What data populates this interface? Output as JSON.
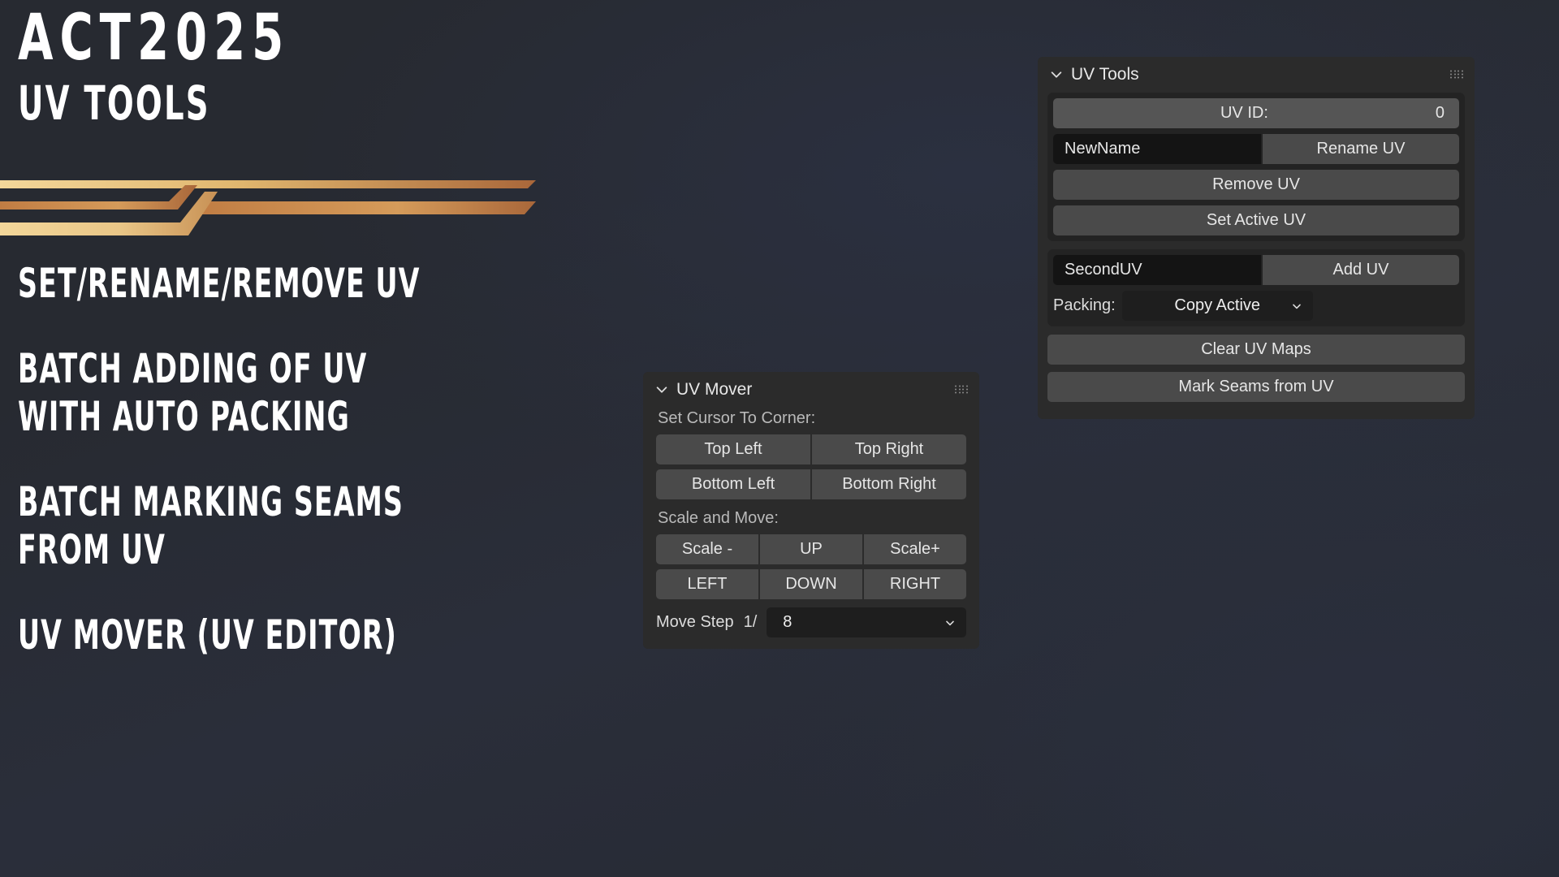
{
  "promo": {
    "title": "ACT2025",
    "subtitle": "UV TOOLS",
    "features": [
      "SET/RENAME/REMOVE UV",
      "BATCH ADDING OF UV\nWITH AUTO PACKING",
      "BATCH MARKING SEAMS\nFROM UV",
      "UV MOVER (UV EDITOR)"
    ],
    "accent_colors": {
      "gold_light": "#f3d79a",
      "gold": "#e0b66e",
      "copper": "#c07c43",
      "copper_dark": "#a9673a"
    }
  },
  "uv_tools": {
    "title": "UV Tools",
    "chevron_icon": "chevron-down-icon",
    "grip_icon": "drag-grip-icon",
    "uv_id": {
      "label": "UV ID:",
      "value": "0"
    },
    "rename": {
      "field_value": "NewName",
      "button_label": "Rename UV"
    },
    "remove_button": "Remove UV",
    "set_active_button": "Set Active UV",
    "add": {
      "field_value": "SecondUV",
      "button_label": "Add UV"
    },
    "packing": {
      "label": "Packing:",
      "selected": "Copy Active",
      "caret_icon": "chevron-down-icon"
    },
    "clear_button": "Clear UV Maps",
    "mark_seams_button": "Mark Seams from UV"
  },
  "uv_mover": {
    "title": "UV Mover",
    "chevron_icon": "chevron-down-icon",
    "grip_icon": "drag-grip-icon",
    "cursor_section_label": "Set Cursor To Corner:",
    "corner_buttons": [
      "Top Left",
      "Top Right",
      "Bottom Left",
      "Bottom Right"
    ],
    "scale_section_label": "Scale and Move:",
    "scale_row": [
      "Scale -",
      "UP",
      "Scale+"
    ],
    "move_row": [
      "LEFT",
      "DOWN",
      "RIGHT"
    ],
    "move_step": {
      "label": "Move Step",
      "prefix": "1/",
      "selected": "8",
      "caret_icon": "chevron-down-icon"
    }
  },
  "theme": {
    "panel_bg": "#2b2b2b",
    "box_bg": "#232323",
    "button_bg": "#4a4a4a",
    "field_bg": "#141414",
    "text": "#e6e6e6"
  }
}
